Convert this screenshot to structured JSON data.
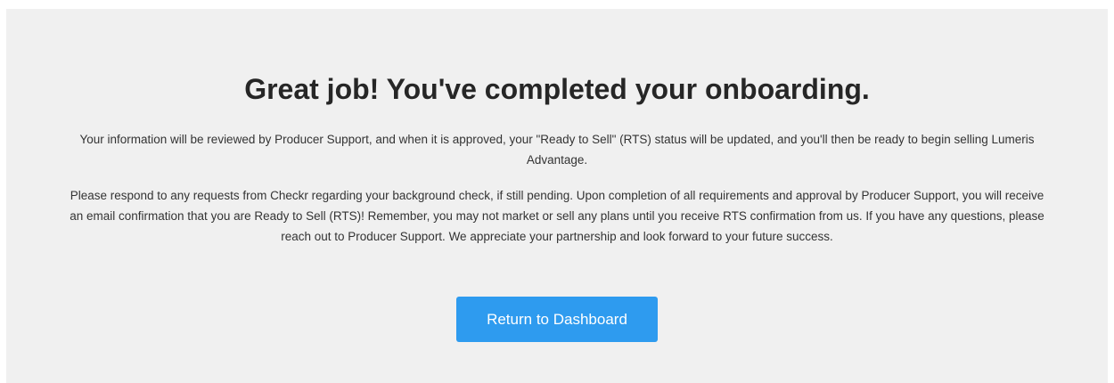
{
  "completion": {
    "heading": "Great job! You've completed your onboarding.",
    "paragraph_1": "Your information will be reviewed by Producer Support, and when it is approved, your \"Ready to Sell\" (RTS) status will be updated, and you'll then be ready to begin selling Lumeris Advantage.",
    "paragraph_2": "Please respond to any requests from Checkr regarding your background check, if still pending. Upon completion of all requirements and approval by Producer Support, you will receive an email confirmation that you are Ready to Sell (RTS)! Remember, you may not market or sell any plans until you receive RTS confirmation from us. If you have any questions, please reach out to Producer Support. We appreciate your partnership and look forward to your future success.",
    "button_label": "Return to Dashboard"
  },
  "colors": {
    "panel_background": "#f0f0f0",
    "button_background": "#2e9bef",
    "button_text": "#ffffff",
    "heading_text": "#262626"
  }
}
